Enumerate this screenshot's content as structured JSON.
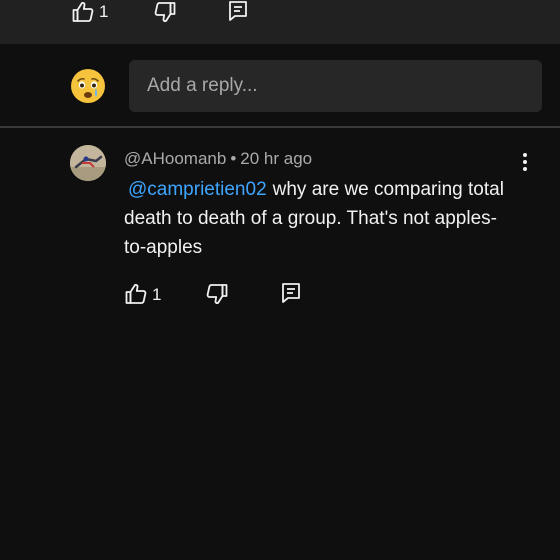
{
  "previous_comment": {
    "like_count": "1"
  },
  "reply_box": {
    "placeholder": "Add a reply..."
  },
  "comment": {
    "author": "@AHoomanb",
    "separator": "•",
    "time": "20 hr ago",
    "mention": "@camprietien02",
    "text": "why are we comparing total death to death of a group. That's not apples-to-apples",
    "like_count": "1"
  },
  "colors": {
    "background": "#0f0f0f",
    "top_strip": "#212121",
    "input_bg": "#272727",
    "mention": "#3ea6ff",
    "meta_text": "#aaaaaa"
  },
  "icons": [
    "thumbs-up-icon",
    "thumbs-down-icon",
    "reply-comment-icon",
    "more-vertical-icon",
    "avatar-emoji-icon"
  ]
}
